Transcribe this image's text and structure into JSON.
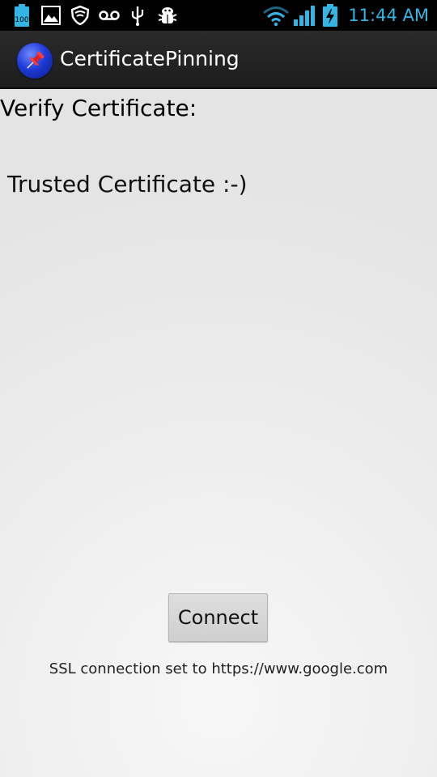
{
  "status_bar": {
    "battery_notification_text": "100",
    "clock": "11:44 AM",
    "icons": [
      "battery-100-icon",
      "picture-icon",
      "lookout-shield-icon",
      "voicemail-icon",
      "usb-icon",
      "android-debug-icon",
      "wifi-icon",
      "signal-icon",
      "battery-charging-icon"
    ],
    "accent_color": "#33b5e5"
  },
  "action_bar": {
    "title": "CertificatePinning",
    "icon": "pushpin-app-icon"
  },
  "main": {
    "verify_label": "Verify Certificate:",
    "result_text": "Trusted Certificate :-)",
    "connect_button": "Connect",
    "ssl_info": "SSL connection set to https://www.google.com"
  }
}
